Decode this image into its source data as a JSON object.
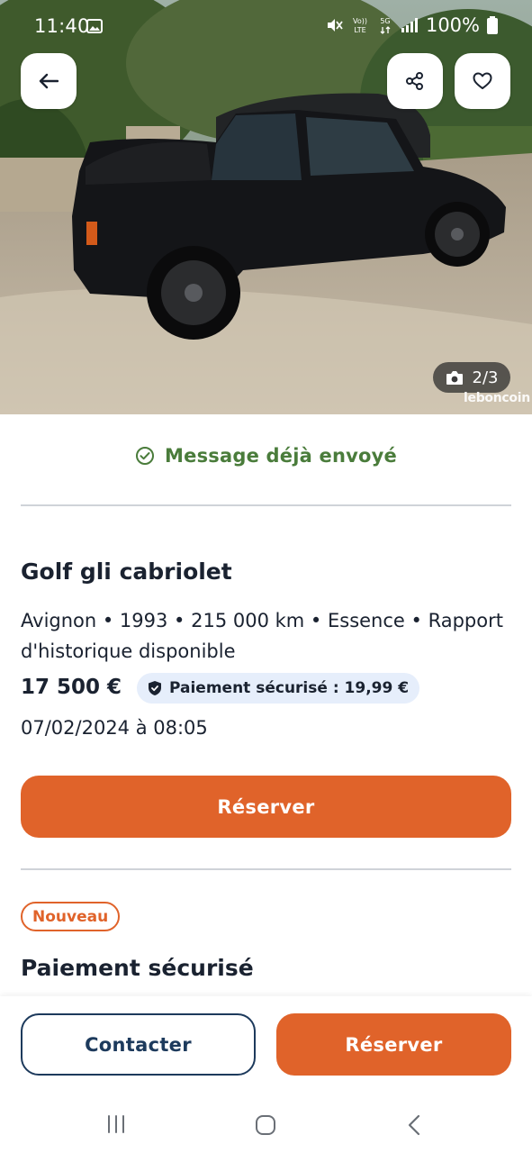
{
  "status_bar": {
    "time": "11:40",
    "volte_label": "Vo)) LTE",
    "network": "5G",
    "battery": "100%"
  },
  "hero": {
    "photo_counter": "2/3",
    "watermark": "leboncoin",
    "icons": [
      "back-arrow-icon",
      "share-icon",
      "heart-icon",
      "camera-icon"
    ]
  },
  "notice": {
    "message_sent": "Message déjà envoyé",
    "color": "#4a7c3b"
  },
  "listing": {
    "title": "Golf gli cabriolet",
    "meta": "Avignon • 1993 • 215 000 km • Essence • Rapport d'historique disponible",
    "price": "17 500 €",
    "secure_payment": "Paiement sécurisé : 19,99 €",
    "date": "07/02/2024 à 08:05",
    "reserve_label": "Réserver"
  },
  "section": {
    "badge": "Nouveau",
    "title": "Paiement sécurisé"
  },
  "actions": {
    "contact_label": "Contacter",
    "reserve_label": "Réserver"
  },
  "colors": {
    "accent": "#e0632a",
    "navy": "#1d3a5c",
    "pill_bg": "#e6eefb"
  }
}
